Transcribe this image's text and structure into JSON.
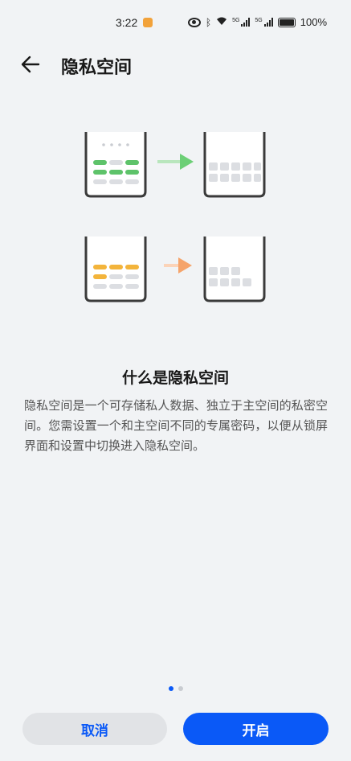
{
  "status_bar": {
    "time": "3:22",
    "battery": "100%",
    "icons": [
      "app-notification-icon",
      "eye-icon",
      "bluetooth-icon",
      "wifi-icon",
      "signal-5g-icon",
      "signal-5g-icon",
      "battery-icon"
    ],
    "network_labels": [
      "5G",
      "5G"
    ]
  },
  "header": {
    "title": "隐私空间",
    "back_icon": "arrow-left-icon"
  },
  "illustration": {
    "accent_green": "#5ec36a",
    "accent_orange": "#f3b43b",
    "arrow_green": "#6ccf76",
    "arrow_orange": "#f5a46b",
    "tile_gray": "#dcdee2",
    "frame_color": "#3a3a3a"
  },
  "info": {
    "title": "什么是隐私空间",
    "description": "隐私空间是一个可存储私人数据、独立于主空间的私密空间。您需设置一个和主空间不同的专属密码，以便从锁屏界面和设置中切换进入隐私空间。"
  },
  "pagination": {
    "current": 1,
    "total": 2
  },
  "actions": {
    "cancel_label": "取消",
    "open_label": "开启",
    "primary_color": "#0a59f7"
  }
}
